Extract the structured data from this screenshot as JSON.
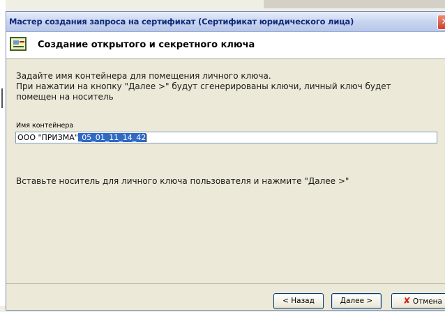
{
  "window": {
    "title": "Мастер создания запроса на сертификат (Сертификат юридического лица)",
    "close_glyph": "✕"
  },
  "header": {
    "title": "Создание открытого и секретного ключа",
    "icon": "certificate-icon"
  },
  "body": {
    "line1": "Задайте имя контейнера для помещения личного ключа.",
    "line2": "При нажатии на кнопку \"Далее >\" будут сгенерированы ключи, личный ключ будет",
    "line3": "помещен на носитель",
    "container_label": "Имя контейнера",
    "container_prefix": "ООО \"ПРИЗМА\"",
    "container_selected": "_05_01_11_14_42",
    "instruction": "Вставьте носитель для личного ключа пользователя и нажмите \"Далее >\""
  },
  "buttons": {
    "back": "< Назад",
    "next": "Далее >",
    "cancel": "Отмена",
    "cancel_icon_glyph": "✘"
  },
  "colors": {
    "selection": "#316ac5",
    "title_text": "#102a7a",
    "cancel_icon": "#d2261a"
  }
}
